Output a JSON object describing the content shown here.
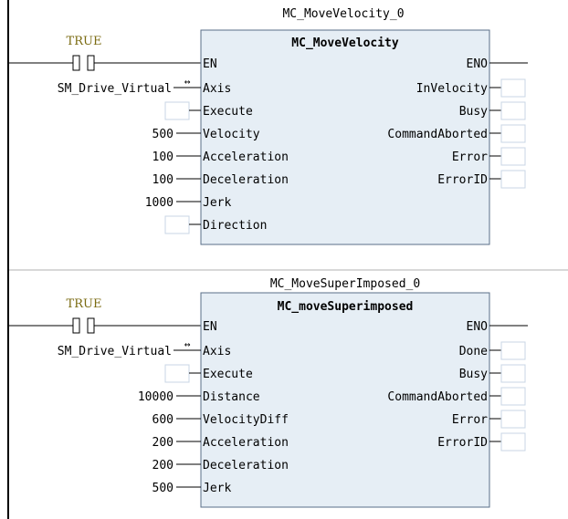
{
  "colors": {
    "block_fill": "#e6eef5",
    "block_border": "#5a6f88",
    "contact_label": "#7a6a10",
    "input_box_border": "#c8d6e4",
    "rung_separator": "#b0b0b0"
  },
  "rungs": [
    {
      "instance_name": "MC_MoveVelocity_0",
      "fb_type": "MC_MoveVelocity",
      "contact_label": "TRUE",
      "axis_variable": "SM_Drive_Virtual",
      "en_label": "EN",
      "eno_label": "ENO",
      "inputs": [
        {
          "name": "Axis",
          "value": "",
          "kind": "axis"
        },
        {
          "name": "Execute",
          "value": "",
          "kind": "box"
        },
        {
          "name": "Velocity",
          "value": "500",
          "kind": "value"
        },
        {
          "name": "Acceleration",
          "value": "100",
          "kind": "value"
        },
        {
          "name": "Deceleration",
          "value": "100",
          "kind": "value"
        },
        {
          "name": "Jerk",
          "value": "1000",
          "kind": "value"
        },
        {
          "name": "Direction",
          "value": "",
          "kind": "box"
        }
      ],
      "outputs": [
        "InVelocity",
        "Busy",
        "CommandAborted",
        "Error",
        "ErrorID"
      ]
    },
    {
      "instance_name": "MC_MoveSuperImposed_0",
      "fb_type": "MC_moveSuperimposed",
      "contact_label": "TRUE",
      "axis_variable": "SM_Drive_Virtual",
      "en_label": "EN",
      "eno_label": "ENO",
      "inputs": [
        {
          "name": "Axis",
          "value": "",
          "kind": "axis"
        },
        {
          "name": "Execute",
          "value": "",
          "kind": "box"
        },
        {
          "name": "Distance",
          "value": "10000",
          "kind": "value"
        },
        {
          "name": "VelocityDiff",
          "value": "600",
          "kind": "value"
        },
        {
          "name": "Acceleration",
          "value": "200",
          "kind": "value"
        },
        {
          "name": "Deceleration",
          "value": "200",
          "kind": "value"
        },
        {
          "name": "Jerk",
          "value": "500",
          "kind": "value"
        }
      ],
      "outputs": [
        "Done",
        "Busy",
        "CommandAborted",
        "Error",
        "ErrorID"
      ]
    }
  ]
}
